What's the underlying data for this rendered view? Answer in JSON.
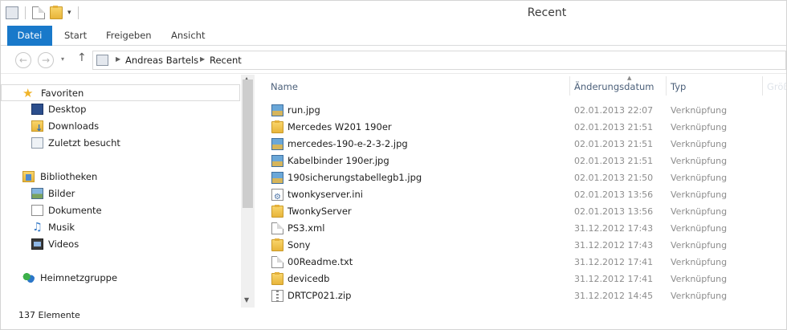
{
  "window": {
    "title": "Recent"
  },
  "ribbon": {
    "tabs": [
      "Datei",
      "Start",
      "Freigeben",
      "Ansicht"
    ]
  },
  "address": {
    "crumbs": [
      "Andreas Bartels",
      "Recent"
    ]
  },
  "nav": {
    "favorites": {
      "label": "Favoriten",
      "items": [
        "Desktop",
        "Downloads",
        "Zuletzt besucht"
      ]
    },
    "libraries": {
      "label": "Bibliotheken",
      "items": [
        "Bilder",
        "Dokumente",
        "Musik",
        "Videos"
      ]
    },
    "homegroup": {
      "label": "Heimnetzgruppe"
    }
  },
  "status": {
    "count": "137 Elemente"
  },
  "columns": {
    "name": "Name",
    "date": "Änderungsdatum",
    "type": "Typ",
    "size": "Größe"
  },
  "files": [
    {
      "name": "run.jpg",
      "date": "02.01.2013 22:07",
      "type": "Verknüpfung",
      "icon": "image-icon"
    },
    {
      "name": "Mercedes W201 190er",
      "date": "02.01.2013 21:51",
      "type": "Verknüpfung",
      "icon": "folder-icon"
    },
    {
      "name": "mercedes-190-e-2-3-2.jpg",
      "date": "02.01.2013 21:51",
      "type": "Verknüpfung",
      "icon": "image-icon"
    },
    {
      "name": "Kabelbinder 190er.jpg",
      "date": "02.01.2013 21:51",
      "type": "Verknüpfung",
      "icon": "image-icon"
    },
    {
      "name": "190sicherungstabellegb1.jpg",
      "date": "02.01.2013 21:50",
      "type": "Verknüpfung",
      "icon": "image-icon"
    },
    {
      "name": "twonkyserver.ini",
      "date": "02.01.2013 13:56",
      "type": "Verknüpfung",
      "icon": "settings-file-icon"
    },
    {
      "name": "TwonkyServer",
      "date": "02.01.2013 13:56",
      "type": "Verknüpfung",
      "icon": "folder-icon"
    },
    {
      "name": "PS3.xml",
      "date": "31.12.2012 17:43",
      "type": "Verknüpfung",
      "icon": "document-icon"
    },
    {
      "name": "Sony",
      "date": "31.12.2012 17:43",
      "type": "Verknüpfung",
      "icon": "folder-icon"
    },
    {
      "name": "00Readme.txt",
      "date": "31.12.2012 17:41",
      "type": "Verknüpfung",
      "icon": "document-icon"
    },
    {
      "name": "devicedb",
      "date": "31.12.2012 17:41",
      "type": "Verknüpfung",
      "icon": "folder-icon"
    },
    {
      "name": "DRTCP021.zip",
      "date": "31.12.2012 14:45",
      "type": "Verknüpfung",
      "icon": "zip-icon"
    }
  ]
}
